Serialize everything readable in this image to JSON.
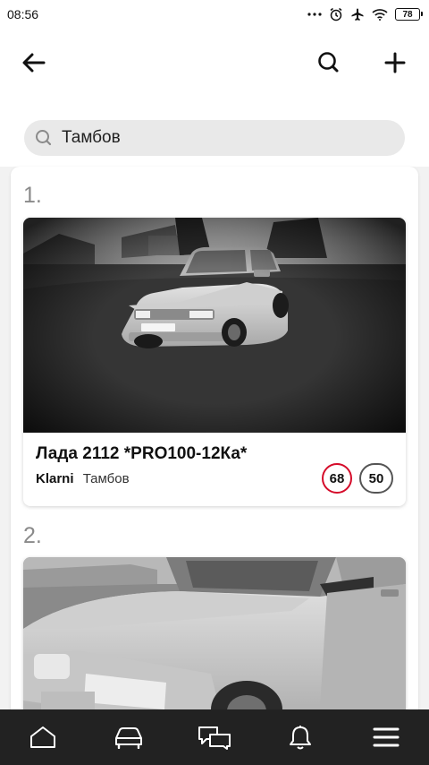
{
  "status_bar": {
    "time": "08:56",
    "battery": "78",
    "icons": [
      "more-dots-icon",
      "alarm-icon",
      "airplane-icon",
      "wifi-icon",
      "battery-icon"
    ]
  },
  "app_bar": {
    "icons": [
      "back-arrow-icon",
      "search-icon",
      "plus-icon"
    ]
  },
  "search": {
    "value": "Тамбов",
    "icon": "search-icon"
  },
  "results": [
    {
      "index": "1.",
      "title": "Лада 2112 *PRO100-12Ка*",
      "author": "Klarni",
      "city": "Тамбов",
      "badge_primary": "68",
      "badge_secondary": "50"
    },
    {
      "index": "2."
    }
  ],
  "bottom_nav": {
    "items": [
      "home-icon",
      "car-icon",
      "chat-icon",
      "bell-icon",
      "menu-icon"
    ]
  },
  "colors": {
    "accent_red": "#d50b2a",
    "nav_bg": "#222222",
    "search_bg": "#e9e9e9"
  }
}
